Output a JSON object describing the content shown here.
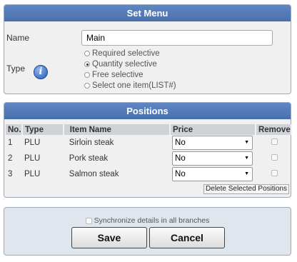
{
  "set_menu": {
    "title": "Set Menu",
    "name_label": "Name",
    "name_value": "Main",
    "type_label": "Type",
    "type_options": [
      {
        "label": "Required selective",
        "checked": false
      },
      {
        "label": "Quantity selective",
        "checked": true
      },
      {
        "label": "Free selective",
        "checked": false
      },
      {
        "label": "Select one item(LIST#)",
        "checked": false
      }
    ]
  },
  "positions": {
    "title": "Positions",
    "columns": [
      "No.",
      "Type",
      "Item Name",
      "Price",
      "Remove"
    ],
    "rows": [
      {
        "no": "1",
        "type": "PLU",
        "item": "Sirloin steak",
        "price": "No"
      },
      {
        "no": "2",
        "type": "PLU",
        "item": "Pork steak",
        "price": "No"
      },
      {
        "no": "3",
        "type": "PLU",
        "item": "Salmon steak",
        "price": "No"
      }
    ],
    "delete_label": "Delete Selected Positions"
  },
  "footer": {
    "sync_label": "Synchronize details in all branches",
    "save_label": "Save",
    "cancel_label": "Cancel"
  },
  "icons": {
    "info": "info-icon",
    "dropdown": "chevron-down-icon"
  }
}
